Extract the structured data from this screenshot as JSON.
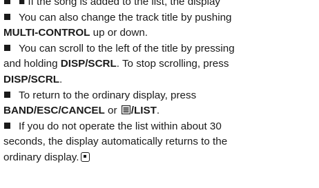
{
  "paragraphs": [
    {
      "top_cut_line": "■ If the song is added to the list, the display",
      "text": ""
    }
  ],
  "items": {
    "p0": {
      "text_a": "You can also change the track title by pushing",
      "bold_a": "MULTI-CONTROL",
      "text_b": " up or down."
    },
    "p1": {
      "text_a": "You can scroll to the left of the title by pressing and holding ",
      "bold_a": "DISP/SCRL",
      "text_b": ". To stop scrolling, press ",
      "bold_b": "DISP/SCRL",
      "text_c": "."
    },
    "p2": {
      "text_a": "To return to the ordinary display, press",
      "bold_a": "BAND/ESC/CANCEL",
      "text_b": " or ",
      "icon": "list-icon",
      "bold_b": "/LIST",
      "text_c": "."
    },
    "p3": {
      "text_a": "If you do not operate the list within about 30 seconds, the display automatically returns to the ordinary display.",
      "end_icon": "end-of-section-icon"
    }
  }
}
